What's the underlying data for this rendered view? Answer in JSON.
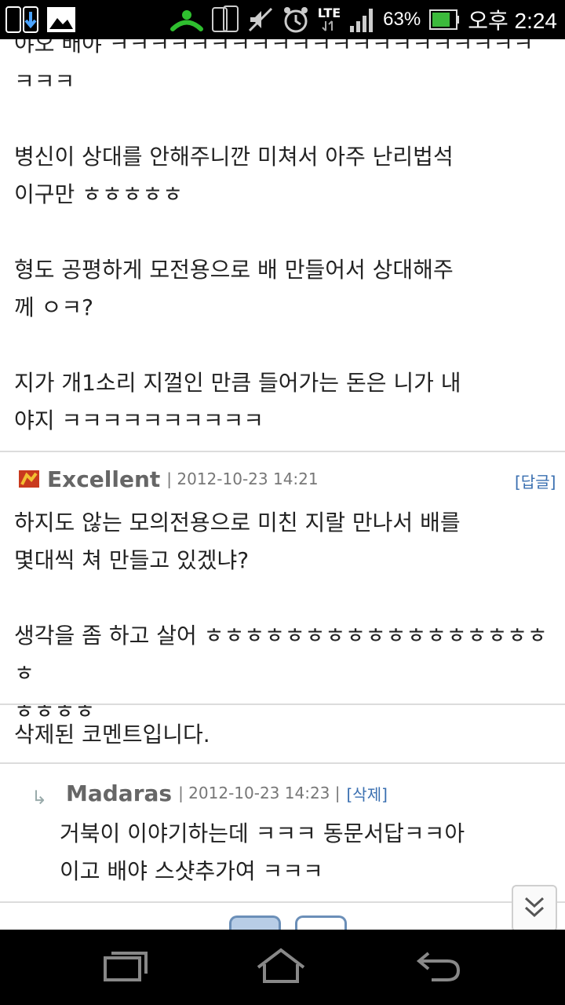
{
  "status_bar": {
    "battery_percent": "63%",
    "time": "오후 2:24",
    "network": "LTE",
    "icons": [
      "download-icon",
      "image-icon",
      "call-icon",
      "phone-icon",
      "mute-icon",
      "alarm-icon",
      "signal-icon",
      "battery-icon"
    ]
  },
  "posts": [
    {
      "text": "야오 배야 ㅋㅋㅋㅋㅋㅋㅋㅋㅋㅋㅋㅋㅋㅋㅋㅋㅋㅋㅋㅋㅋ\nㅋㅋㅋ\n\n병신이 상대를 안해주니깐 미쳐서 아주 난리법석\n이구만 ㅎㅎㅎㅎㅎ\n\n형도 공평하게 모전용으로 배 만들어서 상대해주\n께 ㅇㅋ?\n\n지가 개1소리 지껄인 만큼 들어가는 돈은 니가 내\n야지 ㅋㅋㅋㅋㅋㅋㅋㅋㅋㅋ"
    }
  ],
  "comments": [
    {
      "author": "Excellent",
      "date": "| 2012-10-23 14:21",
      "reply_label": "[답글]",
      "text": "하지도 않는 모의전용으로 미친 지랄 만나서 배를\n몇대씩 쳐 만들고 있겠냐?\n\n생각을 좀 하고 살어 ㅎㅎㅎㅎㅎㅎㅎㅎㅎㅎㅎㅎㅎㅎㅎㅎㅎㅎ\nㅎㅎㅎㅎ"
    },
    {
      "deleted_text": "삭제된 코멘트입니다."
    },
    {
      "author": "Madaras",
      "date": "| 2012-10-23 14:23 |",
      "delete_label": "[삭제]",
      "text": "거북이 이야기하는데 ㅋㅋㅋ 동문서답ㅋㅋ아\n이고 배야 스샷추가여 ㅋㅋㅋ"
    }
  ],
  "nav": {
    "icons": [
      "recent-apps-icon",
      "home-icon",
      "back-icon"
    ]
  }
}
